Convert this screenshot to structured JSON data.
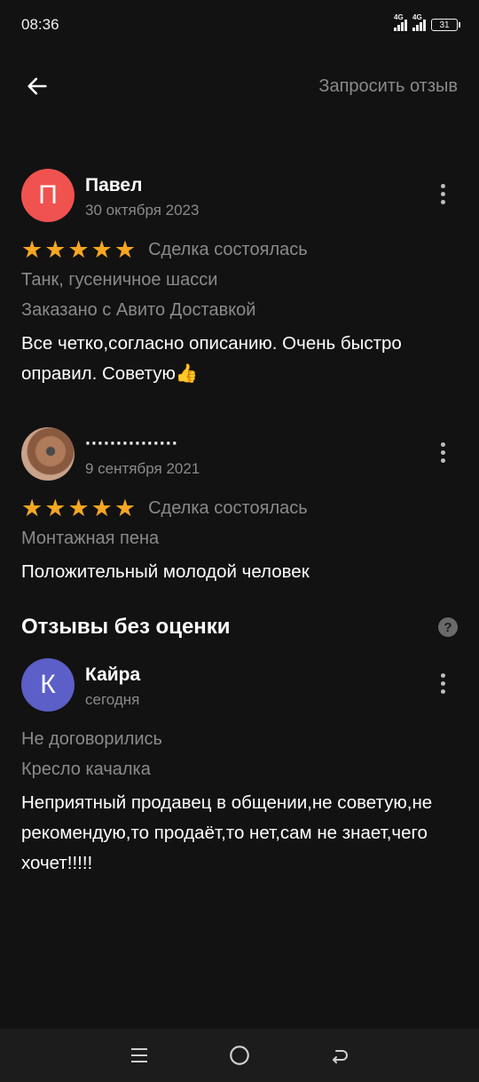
{
  "status_bar": {
    "time": "08:36",
    "network1": "4G",
    "network2": "4G",
    "battery": "31"
  },
  "header": {
    "back_icon": "arrow-left-icon",
    "request_review": "Запросить отзыв"
  },
  "reviews": [
    {
      "avatar_letter": "П",
      "avatar_color": "#f0524f",
      "name": "Павел",
      "date": "30 октября 2023",
      "stars": 5,
      "deal_status": "Сделка состоялась",
      "item": "Танк, гусеничное шасси",
      "delivery": "Заказано с Авито Доставкой",
      "text": "Все четко,согласно описанию. Очень быстро оправил. Советую👍"
    },
    {
      "avatar_letter": "",
      "name": "···············",
      "date": "9 сентября 2021",
      "stars": 5,
      "deal_status": "Сделка состоялась",
      "item": "Монтажная пена",
      "text": "Положительный молодой человек"
    }
  ],
  "unrated_section": {
    "title": "Отзывы без оценки",
    "help_icon": "question-icon",
    "reviews": [
      {
        "avatar_letter": "К",
        "avatar_color": "#5b5fc7",
        "name": "Кайра",
        "date": "сегодня",
        "deal_status": "Не договорились",
        "item": "Кресло качалка",
        "text": "Неприятный продавец в общении,не советую,не рекомендую,то продаёт,то нет,сам не знает,чего хочет!!!!!"
      }
    ]
  },
  "colors": {
    "background": "#121212",
    "star": "#f5a623",
    "muted_text": "#8a8a8a"
  },
  "nav_bar": {
    "menu_icon": "menu-icon",
    "home_icon": "home-circle-icon",
    "back_icon": "back-icon"
  }
}
